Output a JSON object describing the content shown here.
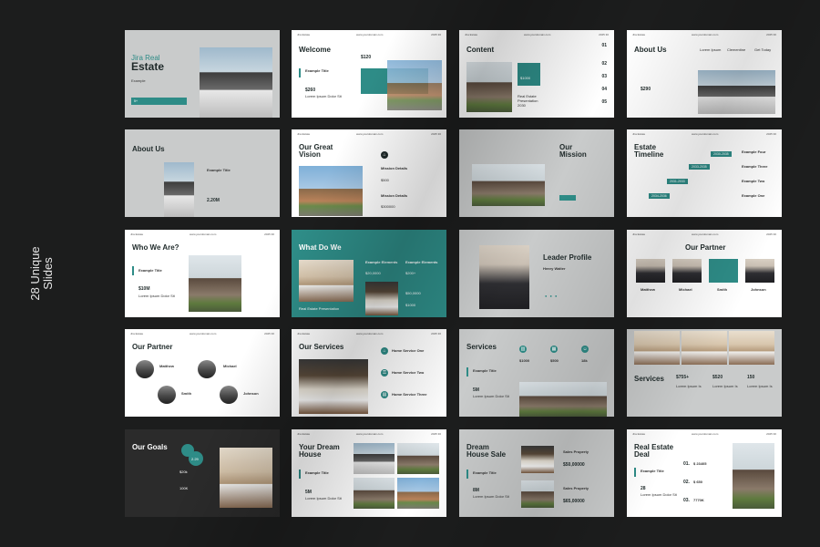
{
  "side_label": {
    "line1": "28 Unique",
    "line2": "Slides"
  },
  "header": {
    "left": "Jira Estate",
    "mid": "www.yourdomain.com",
    "right": "2025 30"
  },
  "slides": {
    "s1": {
      "line1": "Jira Real",
      "line2": "Estate",
      "sub": "Example",
      "badge": "5+"
    },
    "s2": {
      "title": "Welcome",
      "sub": "Example Title",
      "v1": "$120",
      "v2": "$260",
      "v3": "Lorem Ipsum Dolor Sit"
    },
    "s3": {
      "title": "Content",
      "label": "Real Estate Presentation 2030",
      "value": "$1000",
      "n1": "01",
      "n2": "02",
      "n3": "03",
      "n4": "04",
      "n5": "05"
    },
    "s4": {
      "title": "About Us",
      "c1": "Lorem Ipsum",
      "c2": "Clementine",
      "c3": "Get Today",
      "v": "$290"
    },
    "s5": {
      "title": "About Us",
      "sub": "Example Title",
      "v": "2.20M"
    },
    "s6": {
      "title1": "Our Great",
      "title2": "Vision",
      "sub1": "Mission Details",
      "sub2": "Mission Details",
      "v1": "$500",
      "v2": "$300000"
    },
    "s7": {
      "title1": "Our",
      "title2": "Mission"
    },
    "s8": {
      "title1": "Estate",
      "title2": "Timeline",
      "t1": "2030-2035",
      "t2": "2033-2035",
      "t3": "2031-2033",
      "t4": "2034-2036",
      "e1": "Example Four",
      "e2": "Example Three",
      "e3": "Example Two",
      "e4": "Example One"
    },
    "s9": {
      "title": "Who We Are?",
      "sub": "Example Title",
      "v": "$10M",
      "line": "Lorem Ipsum Dolor Sit"
    },
    "s10": {
      "title": "What Do We",
      "e1": "Example Elements",
      "e2": "Example Elements",
      "v1": "$20,0000",
      "v2": "$200+",
      "v3": "$50,0000",
      "v4": "$1000",
      "footer": "Real Estate Presentation"
    },
    "s11": {
      "title": "Leader Profile",
      "name": "Henry Walter"
    },
    "s12": {
      "title": "Our Partner",
      "p1": "Matthew",
      "p2": "Michael",
      "p3": "Smith",
      "p4": "Johnson"
    },
    "s13": {
      "title": "Our Partner",
      "p1": "Matthew",
      "p2": "Michael",
      "p3": "Smith",
      "p4": "Johnson"
    },
    "s14": {
      "title": "Our Services",
      "l1": "Home Service One",
      "l2": "Home Service Two",
      "l3": "Home Service Three"
    },
    "s15": {
      "title": "Services",
      "sub": "Example Title",
      "v1": "$1000",
      "v2": "$500",
      "v3": "18k",
      "v4": "5M",
      "line": "Lorem Ipsum Dolor Sit"
    },
    "s16": {
      "title": "Services",
      "v1": "$755+",
      "v2": "$520",
      "v3": "150",
      "l1": "Lorem Ipsum Is",
      "l2": "Lorem Ipsum Is",
      "l3": "Lorem Ipsum Is"
    },
    "s17": {
      "title": "Our Goals",
      "badge": "2.29",
      "v1": "$20k",
      "v2": "100K"
    },
    "s18": {
      "title1": "Your Dream",
      "title2": "House",
      "sub": "Example Title",
      "v": "5M",
      "line": "Lorem Ipsum Dolor Sit"
    },
    "s19": {
      "title1": "Dream",
      "title2": "House Sale",
      "sub": "Example Title",
      "v": "8M",
      "line": "Lorem Ipsum Dolor Sit",
      "p1": "Sales Property",
      "v1": "$50,00000",
      "p2": "Sales Property",
      "v2": "$65,00000"
    },
    "s20": {
      "title1": "Real Estate",
      "title2": "Deal",
      "sub": "Example Title",
      "v": "28",
      "line": "Lorem Ipsum Dolor Sit",
      "n1": "01.",
      "n2": "02.",
      "n3": "03.",
      "a1": "$ 23405",
      "a2": "$ 650",
      "a3": "7770K"
    }
  }
}
